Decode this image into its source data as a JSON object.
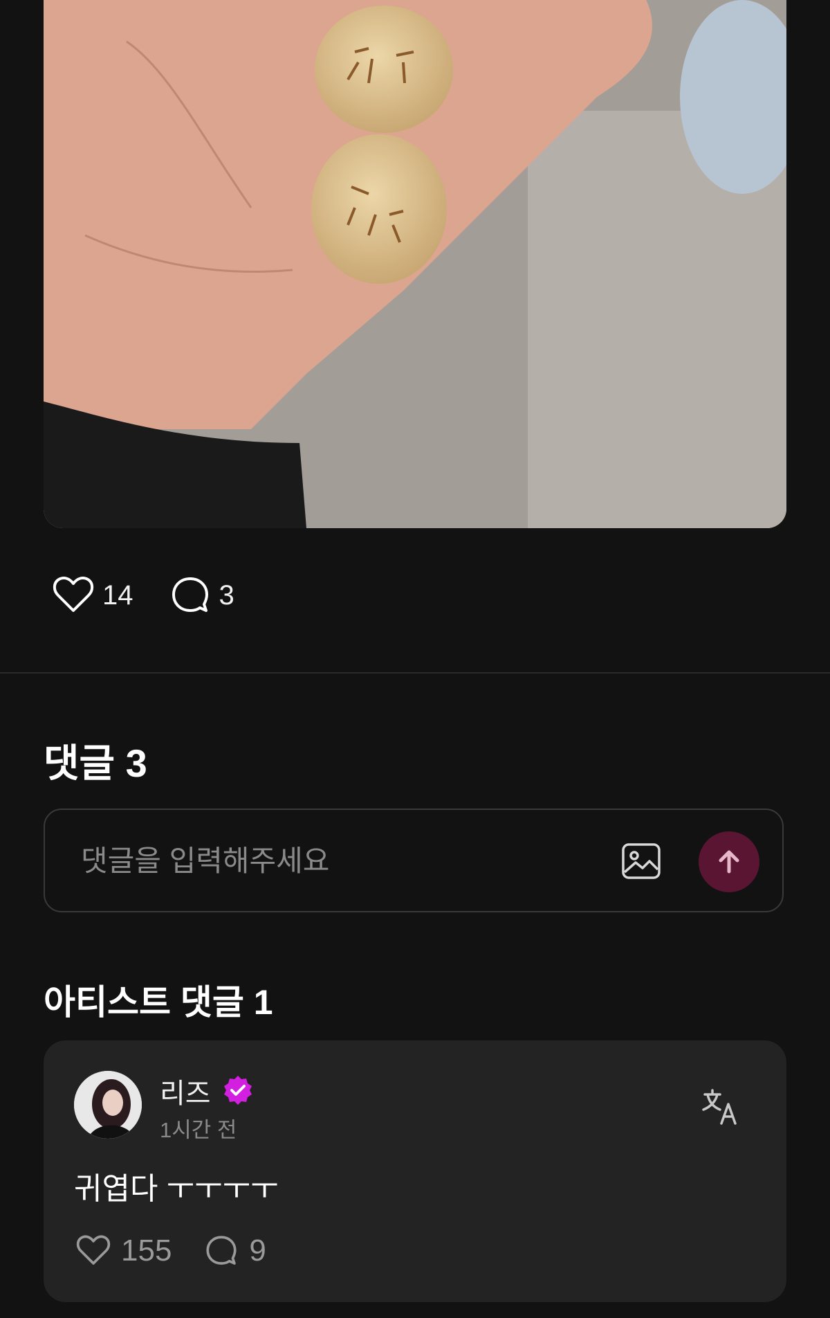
{
  "post": {
    "likes": "14",
    "comments": "3"
  },
  "comments_section": {
    "title": "댓글 3",
    "input_placeholder": "댓글을 입력해주세요"
  },
  "artist_section": {
    "title": "아티스트 댓글 1",
    "comment": {
      "author": "리즈",
      "time": "1시간 전",
      "text": "귀엽다 ㅜㅜㅜㅜ",
      "likes": "155",
      "replies": "9"
    }
  },
  "colors": {
    "background": "#121212",
    "card": "#232323",
    "send_button": "#5a1533",
    "verified_badge": "#d21fe0"
  },
  "icons": [
    "heart-icon",
    "speech-bubble-icon",
    "image-icon",
    "arrow-up-icon",
    "verified-badge-icon",
    "translate-icon"
  ]
}
